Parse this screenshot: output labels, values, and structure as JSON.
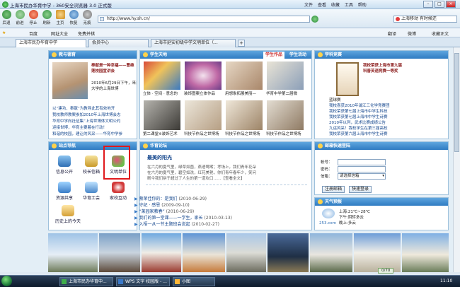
{
  "browser": {
    "title": "上海市民办华育中学 - 360安全浏览器 3.0 正式版",
    "menu": [
      "文件",
      "查看",
      "收藏",
      "工具",
      "帮助"
    ],
    "nav": {
      "back": "后退",
      "forward": "前进",
      "stop": "停止",
      "refresh": "刷新",
      "home": "主页",
      "restore": "恢复",
      "traceless": "无痕"
    },
    "address": "http://www.hy.sh.cn/",
    "search_placeholder": "上海移动 有时候还",
    "favorites": {
      "baidu": "百度",
      "sites": "网址大全",
      "games": "免费并棋",
      "translate": "翻译",
      "weibo": "微博",
      "favorites_bar": "收藏正文"
    },
    "tabs": [
      {
        "label": "上海市民办华育中学",
        "active": true
      },
      {
        "label": "会员中心",
        "active": false
      },
      {
        "label": "上海市延安初级中学文明单位（...",
        "active": false
      }
    ]
  },
  "site": {
    "teacher": {
      "title": "教与德育",
      "headline": "奉献是一种幸福——曹维莲校园宣讲会",
      "lines": [
        "2010年6月29日下午，来自于华东理工",
        "大学的上海世博"
      ],
      "list": [
        "以“建功、奉献”为教导此其有效地开",
        "我校教师教案参加2010年上海世博会志",
        "华育中学向社征集“上海世博体文明公约",
        "迎接世博，华育主要着在行动！",
        "和谐的校园，建让的风采——华育中学参"
      ]
    },
    "students": {
      "title": "学生天地",
      "tab_works": "学生作品",
      "tab_activities": "学生活动",
      "captions_row1": [
        "立体 · 空间 · 意念的",
        "装饰图案立体作品",
        "用想象拓展美丽—",
        "华育中学第二届微"
      ],
      "captions_row2": [
        "第二课堂※装饰艺术",
        "科技节作品之世博场",
        "科技节作品之世博场",
        "科技节作品之世博场"
      ]
    },
    "honors": {
      "title": "学科竞赛",
      "side_headline": "我校荣获上海市第九届科普英语竞赛一等奖",
      "side_label": "蓝球赛",
      "list": [
        "我校喜获2010年浦江三化学竞赛团",
        "我校荣获第七届上海市中学生科技",
        "我校荣获第七届上海市中学生诗赛",
        "2010年以列，武术比赛成绩公告",
        "九运风采！我校学生在第三届高校",
        "我校荣获第六届上海市中学生诗赛"
      ]
    },
    "navlinks": {
      "title": "站点导航",
      "items": [
        "信息公开",
        "校长信箱",
        "文明单位",
        "资源共享",
        "华育工会",
        "家校互动",
        "历史上的今天"
      ]
    },
    "forum": {
      "title": "华育论坛",
      "feature_title": "最美的阳光",
      "feature_text": [
        "在六月的夏气里，绿草如茵，燕语莺啭；考场上，我们青年花朵",
        "在六月的夏气里，碧空如洗，红花美艳，你们青年春年少，笑问",
        "断今我们拼于超过了人生的第一道坎口……【查看全文】"
      ],
      "posts": [
        {
          "title": "蔡荣佳你的：是我们",
          "date": "(2010-06-29)"
        },
        {
          "title": "守纪 · 感恩",
          "date": "(2009-09-10)"
        },
        {
          "title": "“莱园家教春”",
          "date": "(2010-06-29)"
        },
        {
          "title": "我们的第一堂课——一学生，家长",
          "date": "(2010-03-13)"
        },
        {
          "title": "入梧一从一节主题班会说起",
          "date": "(2010-02-27)"
        }
      ]
    },
    "mail": {
      "title": "邮箱快速登陆",
      "account_label": "帐号：",
      "password_label": "密码：",
      "mailbox_label": "信箱：",
      "mailbox_select": "请选择信箱",
      "register_button": "注册邮箱",
      "login_button": "快速登录"
    },
    "weather": {
      "title": "天气预报",
      "city_temp": "上海:21℃~28℃",
      "day": "下午:阴转多云",
      "night": "晚上:多云",
      "provider": "253.com"
    }
  },
  "taskbar": {
    "items": [
      "上海市民办华育中...",
      "WPS 文字 校园版 - ...",
      "小图"
    ],
    "clock": "11:10",
    "counter": "0/70"
  }
}
